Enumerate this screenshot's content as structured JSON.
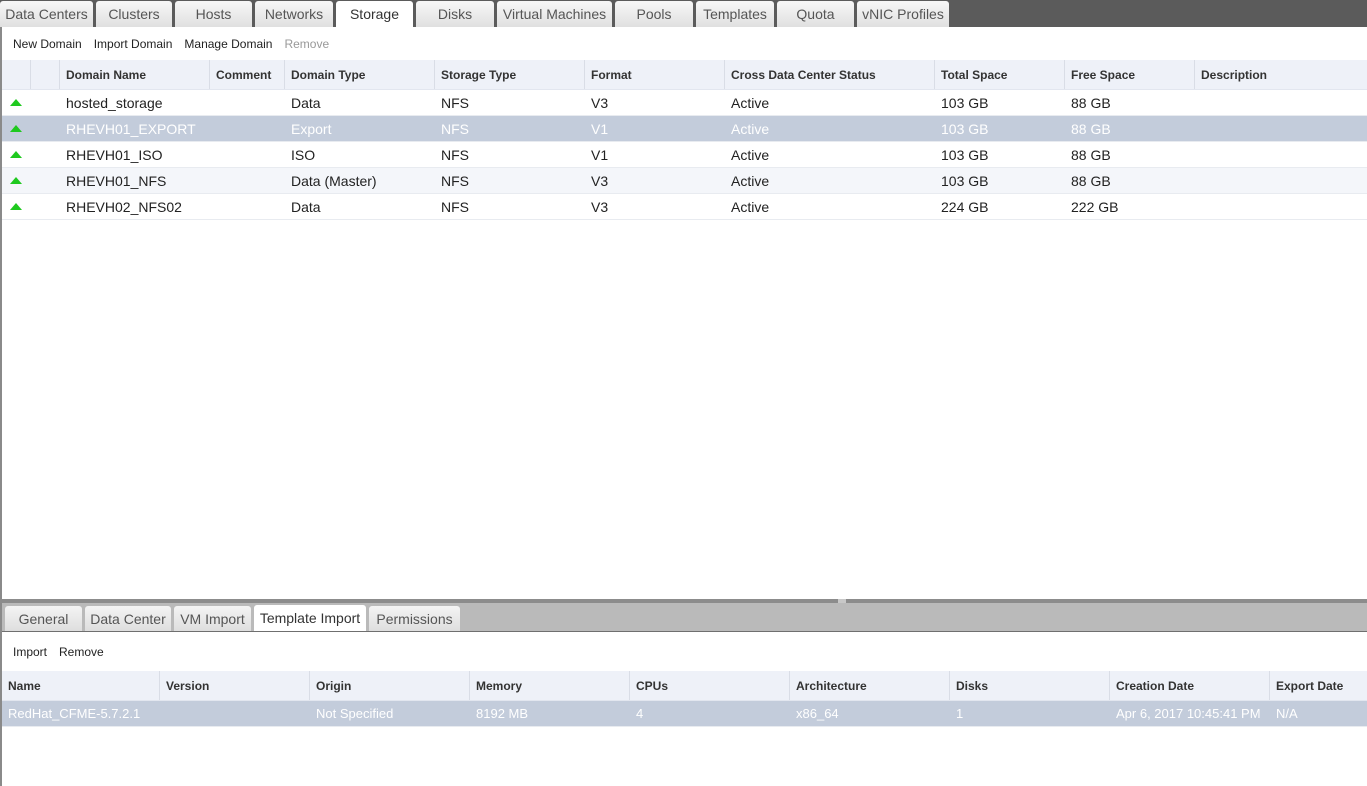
{
  "main_tabs": [
    {
      "label": "Data Centers",
      "active": false
    },
    {
      "label": "Clusters",
      "active": false
    },
    {
      "label": "Hosts",
      "active": false
    },
    {
      "label": "Networks",
      "active": false
    },
    {
      "label": "Storage",
      "active": true
    },
    {
      "label": "Disks",
      "active": false
    },
    {
      "label": "Virtual Machines",
      "active": false
    },
    {
      "label": "Pools",
      "active": false
    },
    {
      "label": "Templates",
      "active": false
    },
    {
      "label": "Quota",
      "active": false
    },
    {
      "label": "vNIC Profiles",
      "active": false
    }
  ],
  "actions": {
    "new_domain": "New Domain",
    "import_domain": "Import Domain",
    "manage_domain": "Manage Domain",
    "remove": "Remove"
  },
  "storage_table": {
    "columns": [
      "",
      "",
      "Domain Name",
      "Comment",
      "Domain Type",
      "Storage Type",
      "Format",
      "Cross Data Center Status",
      "Total Space",
      "Free Space",
      "Description"
    ],
    "rows": [
      {
        "status": "up-icon",
        "name": "hosted_storage",
        "comment": "",
        "domain_type": "Data",
        "storage_type": "NFS",
        "format": "V3",
        "cross_dc_status": "Active",
        "total_space": "103 GB",
        "free_space": "88 GB",
        "description": ""
      },
      {
        "status": "up-icon",
        "name": "RHEVH01_EXPORT",
        "comment": "",
        "domain_type": "Export",
        "storage_type": "NFS",
        "format": "V1",
        "cross_dc_status": "Active",
        "total_space": "103 GB",
        "free_space": "88 GB",
        "description": "",
        "selected": true
      },
      {
        "status": "up-icon",
        "name": "RHEVH01_ISO",
        "comment": "",
        "domain_type": "ISO",
        "storage_type": "NFS",
        "format": "V1",
        "cross_dc_status": "Active",
        "total_space": "103 GB",
        "free_space": "88 GB",
        "description": ""
      },
      {
        "status": "up-icon",
        "name": "RHEVH01_NFS",
        "comment": "",
        "domain_type": "Data (Master)",
        "storage_type": "NFS",
        "format": "V3",
        "cross_dc_status": "Active",
        "total_space": "103 GB",
        "free_space": "88 GB",
        "description": ""
      },
      {
        "status": "up-icon",
        "name": "RHEVH02_NFS02",
        "comment": "",
        "domain_type": "Data",
        "storage_type": "NFS",
        "format": "V3",
        "cross_dc_status": "Active",
        "total_space": "224 GB",
        "free_space": "222 GB",
        "description": ""
      }
    ]
  },
  "sub_tabs": [
    {
      "label": "General",
      "active": false
    },
    {
      "label": "Data Center",
      "active": false
    },
    {
      "label": "VM Import",
      "active": false
    },
    {
      "label": "Template Import",
      "active": true
    },
    {
      "label": "Permissions",
      "active": false
    }
  ],
  "sub_actions": {
    "import": "Import",
    "remove": "Remove"
  },
  "template_table": {
    "columns": [
      "Name",
      "Version",
      "Origin",
      "Memory",
      "CPUs",
      "Architecture",
      "Disks",
      "Creation Date",
      "Export Date"
    ],
    "rows": [
      {
        "name": "RedHat_CFME-5.7.2.1",
        "version": "",
        "origin": "Not Specified",
        "memory": "8192 MB",
        "cpus": "4",
        "architecture": "x86_64",
        "disks": "1",
        "creation_date": "Apr 6, 2017 10:45:41 PM",
        "export_date": "N/A",
        "selected": true
      }
    ]
  },
  "colors": {
    "status_up": "#1fc91f",
    "selected_row": "#c3ccdb",
    "tab_bar": "#5b5b5b"
  }
}
